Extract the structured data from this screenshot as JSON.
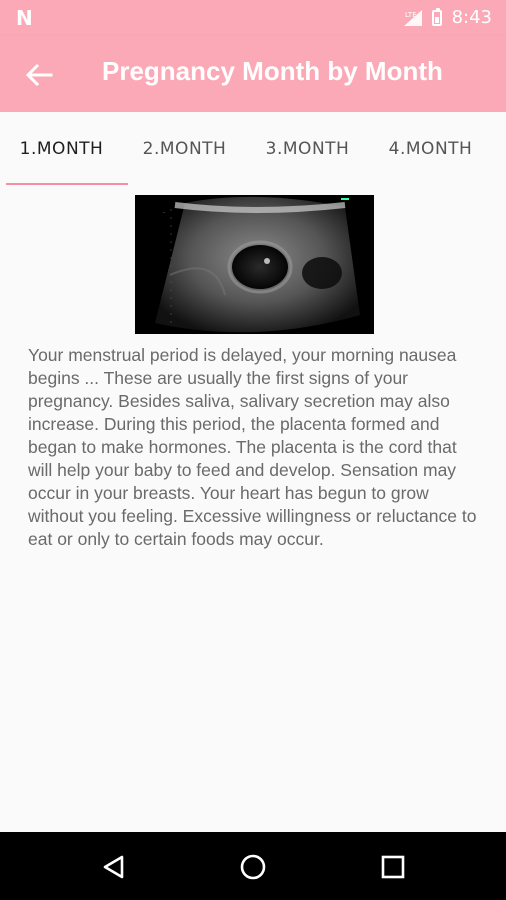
{
  "status": {
    "time": "8:43",
    "left_icon": "notification-n-icon"
  },
  "app_bar": {
    "title": "Pregnancy Month by Month"
  },
  "tabs": [
    {
      "label": "1.MONTH",
      "active": true
    },
    {
      "label": "2.MONTH",
      "active": false
    },
    {
      "label": "3.MONTH",
      "active": false
    },
    {
      "label": "4.MONTH",
      "active": false
    }
  ],
  "content": {
    "image_label": "ultrasound-image",
    "text": "Your menstrual period is delayed, your morning nausea begins ... These are usually the first signs of your pregnancy. Besides saliva, salivary secretion may also increase. During this period, the placenta formed and began to make hormones. The placenta is the cord that will help your baby to feed and develop. Sensation may occur in your breasts. Your heart has begun to grow without you feeling. Excessive willingness or reluctance to eat or only to certain foods may occur."
  },
  "colors": {
    "primary": "#fca9b7",
    "indicator": "#f68fa3",
    "text": "#6a6a6a"
  }
}
